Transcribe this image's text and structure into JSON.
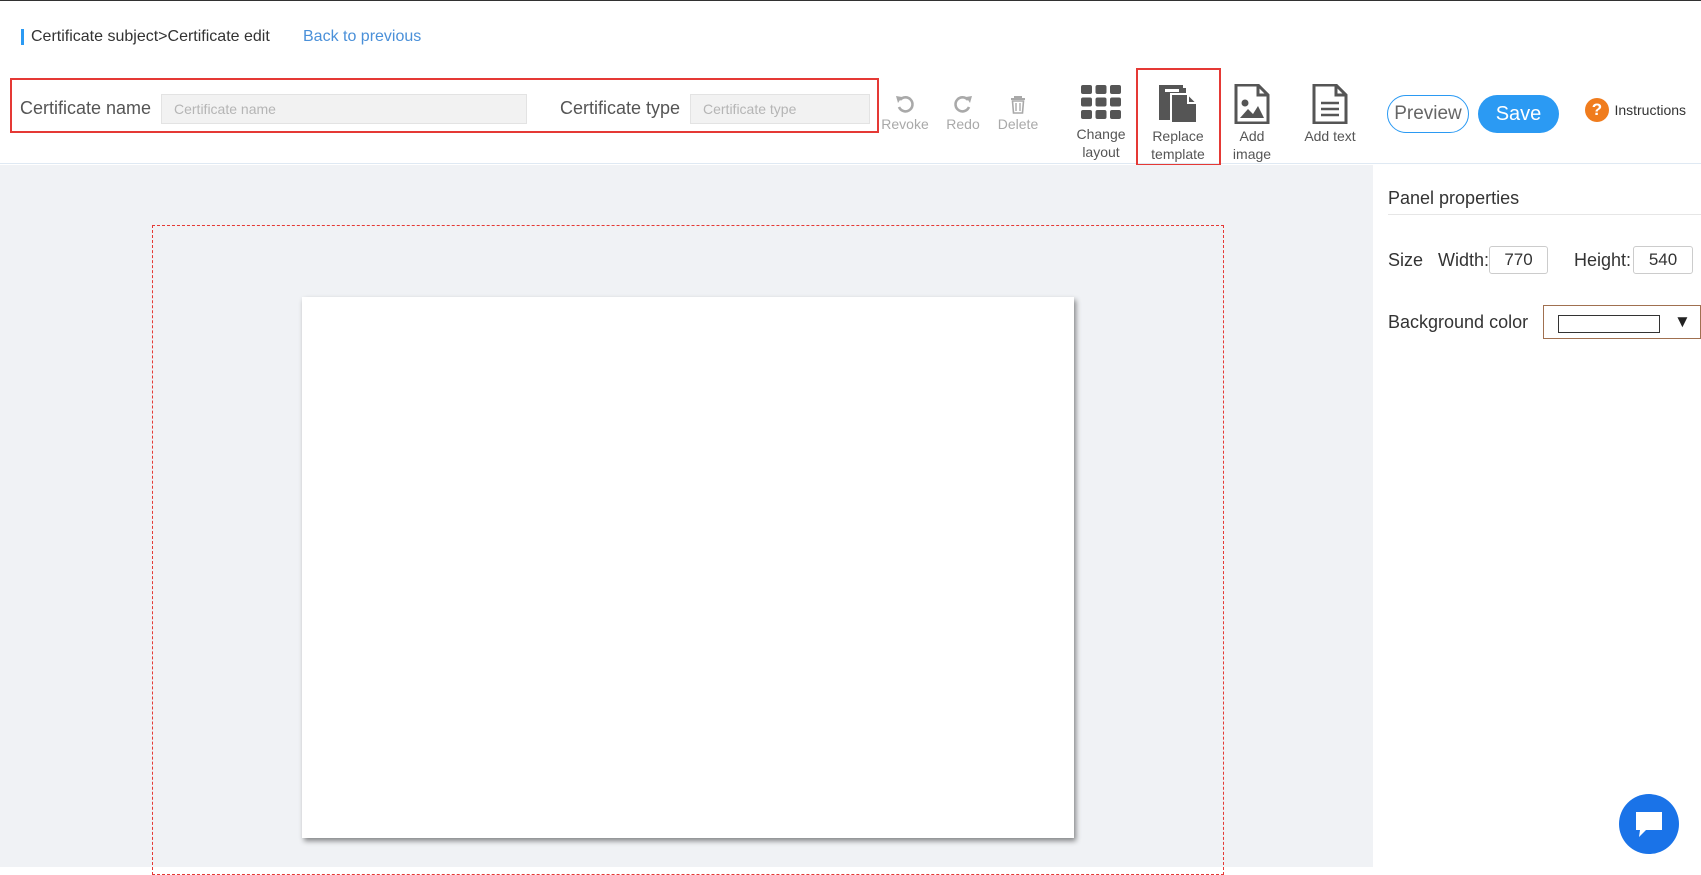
{
  "header": {
    "breadcrumb": "Certificate subject>Certificate edit",
    "back_link": "Back to previous"
  },
  "form": {
    "name_label": "Certificate name",
    "name_placeholder": "Certificate name",
    "name_value": "",
    "type_label": "Certificate type",
    "type_placeholder": "Certificate type",
    "type_value": ""
  },
  "toolbar": {
    "revoke": "Revoke",
    "redo": "Redo",
    "delete": "Delete",
    "change_layout_line1": "Change",
    "change_layout_line2": "layout",
    "replace_template_line1": "Replace",
    "replace_template_line2": "template",
    "add_image_line1": "Add",
    "add_image_line2": "image",
    "add_text": "Add text",
    "preview": "Preview",
    "save": "Save",
    "instructions": "Instructions",
    "instructions_icon": "?"
  },
  "panel": {
    "title": "Panel properties",
    "size_label": "Size",
    "width_label": "Width:",
    "width_value": "770",
    "height_label": "Height:",
    "height_value": "540",
    "bg_label": "Background color",
    "bg_value": "#ffffff",
    "bg_arrow": "▼"
  },
  "colors": {
    "accent": "#2b9af3",
    "highlight": "#e53935",
    "help": "#f07c1d",
    "chat": "#1a73e8"
  },
  "icons": [
    "undo-icon",
    "redo-icon",
    "trash-icon",
    "grid-icon",
    "template-icon",
    "image-icon",
    "document-icon",
    "help-icon",
    "chat-icon"
  ]
}
